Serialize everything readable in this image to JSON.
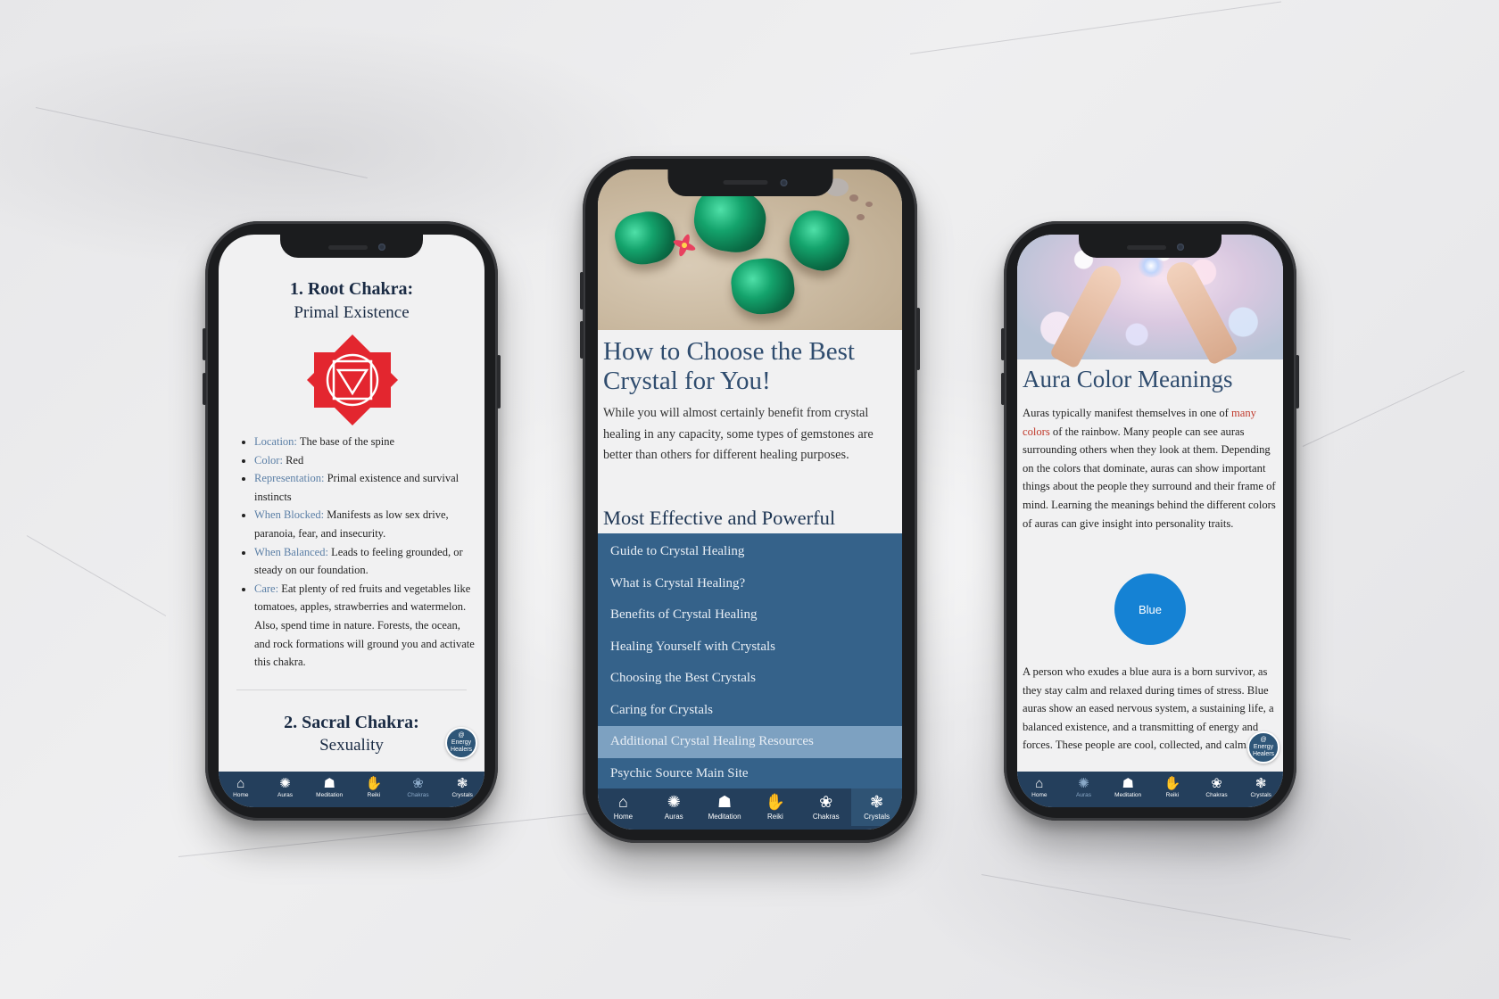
{
  "nav": {
    "items": [
      {
        "label": "Home",
        "icon": "home-icon",
        "glyph": "⌂"
      },
      {
        "label": "Auras",
        "icon": "sun-icon",
        "glyph": "✺"
      },
      {
        "label": "Meditation",
        "icon": "meditation-icon",
        "glyph": "☗"
      },
      {
        "label": "Reiki",
        "icon": "hand-icon",
        "glyph": "✋"
      },
      {
        "label": "Chakras",
        "icon": "lotus-icon",
        "glyph": "❀"
      },
      {
        "label": "Crystals",
        "icon": "crystal-icon",
        "glyph": "❃"
      }
    ]
  },
  "fab": {
    "line1": "@",
    "line2": "Energy",
    "line3": "Healers"
  },
  "phone1": {
    "active_tab": "Chakras",
    "chakra1_title": "1. Root Chakra:",
    "chakra1_subtitle": "Primal Existence",
    "chakra1_color": "#e3262f",
    "details": [
      {
        "label": "Location:",
        "value": "The base of the spine"
      },
      {
        "label": "Color:",
        "value": "Red"
      },
      {
        "label": "Representation:",
        "value": "Primal existence and survival instincts"
      },
      {
        "label": "When Blocked:",
        "value": "Manifests as low sex drive, paranoia, fear, and insecurity."
      },
      {
        "label": "When Balanced:",
        "value": "Leads to feeling grounded, or steady on our foundation."
      },
      {
        "label": "Care:",
        "value": "Eat plenty of red fruits and vegetables like tomatoes, apples, strawberries and watermelon. Also, spend time in nature. Forests, the ocean, and rock formations will ground you and activate this chakra."
      }
    ],
    "chakra2_title": "2. Sacral Chakra:",
    "chakra2_subtitle": "Sexuality"
  },
  "phone2": {
    "active_tab": "Crystals",
    "heading": "How to Choose the Best Crystal for You!",
    "intro": "While you will almost certainly benefit from crystal healing in any capacity, some types of gemstones are better than others for different healing purposes.",
    "section_title": "Most Effective and Powerful",
    "menu": [
      "Guide to Crystal Healing",
      "What is Crystal Healing?",
      "Benefits of Crystal Healing",
      "Healing Yourself with Crystals",
      "Choosing the Best Crystals",
      "Caring for Crystals",
      "Additional Crystal Healing Resources",
      "Psychic Source Main Site"
    ],
    "selected_menu": "Additional Crystal Healing Resources"
  },
  "phone3": {
    "active_tab": "Auras",
    "heading": "Aura Color Meanings",
    "intro_before": "Auras typically manifest themselves in one of ",
    "intro_link": "many colors",
    "intro_after": " of the rainbow. Many people can see auras surrounding others when they look at them. Depending on the colors that dominate, auras can show important things about the people they surround and their frame of mind. Learning the meanings behind the different colors of auras can give insight into personality traits.",
    "color_name": "Blue",
    "color_hex": "#1582d4",
    "color_description": "A person who exudes a blue aura is a born survivor, as they stay calm and relaxed during times of stress. Blue auras show an eased nervous system, a sustaining life, a balanced existence, and a transmitting of energy and forces. These people are cool, collected, and calm."
  }
}
